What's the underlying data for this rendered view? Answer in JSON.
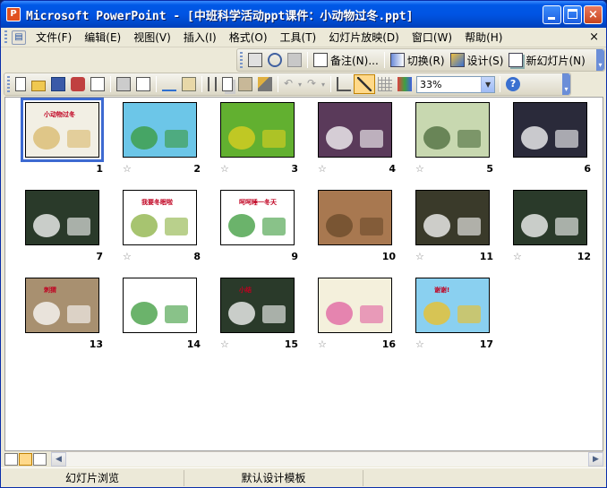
{
  "window": {
    "title": "Microsoft PowerPoint - [中班科学活动ppt课件：小动物过冬.ppt]",
    "app_icon_glyph": "P",
    "controls": {
      "minimize": "minimize-icon",
      "maximize": "maximize-icon",
      "close": "×"
    }
  },
  "menubar": {
    "items": [
      "文件(F)",
      "编辑(E)",
      "视图(V)",
      "插入(I)",
      "格式(O)",
      "工具(T)",
      "幻灯片放映(D)",
      "窗口(W)",
      "帮助(H)"
    ],
    "close_glyph": "×"
  },
  "toolbar1": {
    "notes": "备注(N)...",
    "transition": "切换(R)",
    "design": "设计(S)",
    "new_slide": "新幻灯片(N)"
  },
  "toolbar2": {
    "zoom": "33%",
    "help_glyph": "?"
  },
  "slides": [
    {
      "number": "1",
      "selected": true,
      "has_transition": false,
      "caption": "小动物过冬",
      "bg": "#f2efe4",
      "accent": "#d8b86a"
    },
    {
      "number": "2",
      "selected": false,
      "has_transition": true,
      "caption": "",
      "bg": "#6cc6e8",
      "accent": "#3a9a3a"
    },
    {
      "number": "3",
      "selected": false,
      "has_transition": true,
      "caption": "",
      "bg": "#62b030",
      "accent": "#e0d020"
    },
    {
      "number": "4",
      "selected": false,
      "has_transition": true,
      "caption": "",
      "bg": "#5a3a5a",
      "accent": "#ffffff"
    },
    {
      "number": "5",
      "selected": false,
      "has_transition": true,
      "caption": "",
      "bg": "#c8d8b0",
      "accent": "#4a6a3a"
    },
    {
      "number": "6",
      "selected": false,
      "has_transition": false,
      "caption": "",
      "bg": "#2a2a3a",
      "accent": "#ffffff"
    },
    {
      "number": "7",
      "selected": false,
      "has_transition": false,
      "caption": "",
      "bg": "#2a3a2a",
      "accent": "#ffffff"
    },
    {
      "number": "8",
      "selected": false,
      "has_transition": true,
      "caption": "我要冬眠啦",
      "bg": "#ffffff",
      "accent": "#8ab040"
    },
    {
      "number": "9",
      "selected": false,
      "has_transition": false,
      "caption": "呵呵睡一冬天",
      "bg": "#ffffff",
      "accent": "#3a9a3a"
    },
    {
      "number": "10",
      "selected": false,
      "has_transition": false,
      "caption": "",
      "bg": "#a87850",
      "accent": "#6a4a2a"
    },
    {
      "number": "11",
      "selected": false,
      "has_transition": true,
      "caption": "",
      "bg": "#3a3a2a",
      "accent": "#ffffff"
    },
    {
      "number": "12",
      "selected": false,
      "has_transition": true,
      "caption": "",
      "bg": "#2a3a2a",
      "accent": "#ffffff"
    },
    {
      "number": "13",
      "selected": false,
      "has_transition": false,
      "caption": "刺猬",
      "bg": "#a89070",
      "accent": "#ffffff"
    },
    {
      "number": "14",
      "selected": false,
      "has_transition": false,
      "caption": "",
      "bg": "#ffffff",
      "accent": "#3a9a3a"
    },
    {
      "number": "15",
      "selected": false,
      "has_transition": true,
      "caption": "小结",
      "bg": "#2a3a2a",
      "accent": "#ffffff"
    },
    {
      "number": "16",
      "selected": false,
      "has_transition": true,
      "caption": "",
      "bg": "#f4f0dc",
      "accent": "#e060a0"
    },
    {
      "number": "17",
      "selected": false,
      "has_transition": true,
      "caption": "谢谢!",
      "bg": "#8ad0f0",
      "accent": "#f0c020"
    }
  ],
  "statusbar": {
    "view": "幻灯片浏览",
    "template": "默认设计模板"
  }
}
